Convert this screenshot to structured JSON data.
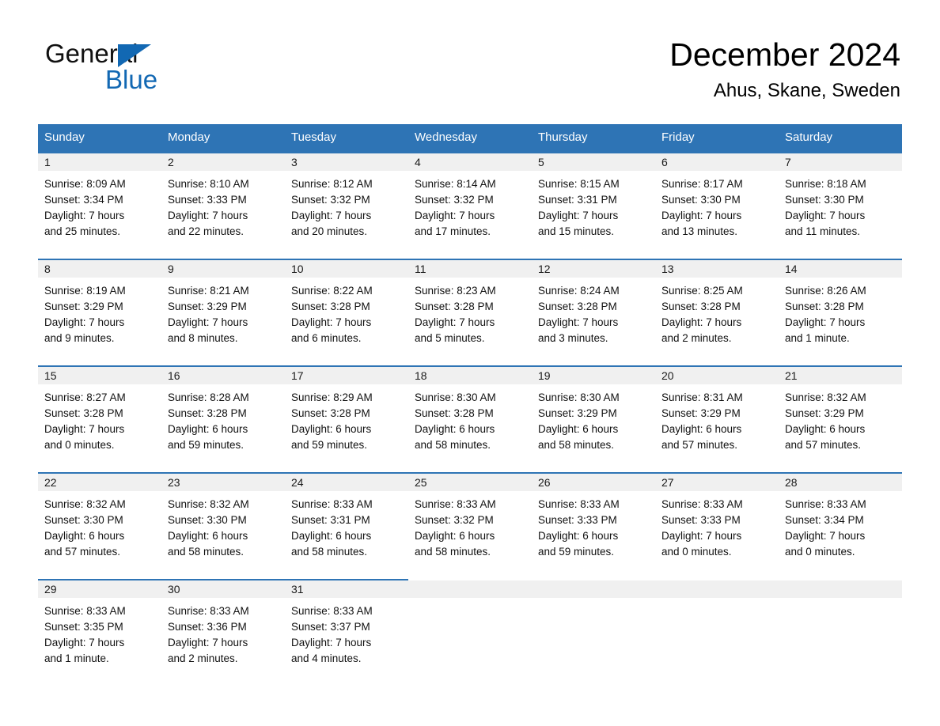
{
  "brand": {
    "line1": "General",
    "line2": "Blue",
    "triangle_color": "#1268b3"
  },
  "header": {
    "title": "December 2024",
    "subtitle": "Ahus, Skane, Sweden"
  },
  "colors": {
    "header_blue": "#2e74b5",
    "day_band_gray": "#f0f0f0",
    "text": "#111111"
  },
  "weekdays": [
    "Sunday",
    "Monday",
    "Tuesday",
    "Wednesday",
    "Thursday",
    "Friday",
    "Saturday"
  ],
  "weeks": [
    [
      {
        "day": "1",
        "sunrise": "Sunrise: 8:09 AM",
        "sunset": "Sunset: 3:34 PM",
        "daylight1": "Daylight: 7 hours",
        "daylight2": "and 25 minutes."
      },
      {
        "day": "2",
        "sunrise": "Sunrise: 8:10 AM",
        "sunset": "Sunset: 3:33 PM",
        "daylight1": "Daylight: 7 hours",
        "daylight2": "and 22 minutes."
      },
      {
        "day": "3",
        "sunrise": "Sunrise: 8:12 AM",
        "sunset": "Sunset: 3:32 PM",
        "daylight1": "Daylight: 7 hours",
        "daylight2": "and 20 minutes."
      },
      {
        "day": "4",
        "sunrise": "Sunrise: 8:14 AM",
        "sunset": "Sunset: 3:32 PM",
        "daylight1": "Daylight: 7 hours",
        "daylight2": "and 17 minutes."
      },
      {
        "day": "5",
        "sunrise": "Sunrise: 8:15 AM",
        "sunset": "Sunset: 3:31 PM",
        "daylight1": "Daylight: 7 hours",
        "daylight2": "and 15 minutes."
      },
      {
        "day": "6",
        "sunrise": "Sunrise: 8:17 AM",
        "sunset": "Sunset: 3:30 PM",
        "daylight1": "Daylight: 7 hours",
        "daylight2": "and 13 minutes."
      },
      {
        "day": "7",
        "sunrise": "Sunrise: 8:18 AM",
        "sunset": "Sunset: 3:30 PM",
        "daylight1": "Daylight: 7 hours",
        "daylight2": "and 11 minutes."
      }
    ],
    [
      {
        "day": "8",
        "sunrise": "Sunrise: 8:19 AM",
        "sunset": "Sunset: 3:29 PM",
        "daylight1": "Daylight: 7 hours",
        "daylight2": "and 9 minutes."
      },
      {
        "day": "9",
        "sunrise": "Sunrise: 8:21 AM",
        "sunset": "Sunset: 3:29 PM",
        "daylight1": "Daylight: 7 hours",
        "daylight2": "and 8 minutes."
      },
      {
        "day": "10",
        "sunrise": "Sunrise: 8:22 AM",
        "sunset": "Sunset: 3:28 PM",
        "daylight1": "Daylight: 7 hours",
        "daylight2": "and 6 minutes."
      },
      {
        "day": "11",
        "sunrise": "Sunrise: 8:23 AM",
        "sunset": "Sunset: 3:28 PM",
        "daylight1": "Daylight: 7 hours",
        "daylight2": "and 5 minutes."
      },
      {
        "day": "12",
        "sunrise": "Sunrise: 8:24 AM",
        "sunset": "Sunset: 3:28 PM",
        "daylight1": "Daylight: 7 hours",
        "daylight2": "and 3 minutes."
      },
      {
        "day": "13",
        "sunrise": "Sunrise: 8:25 AM",
        "sunset": "Sunset: 3:28 PM",
        "daylight1": "Daylight: 7 hours",
        "daylight2": "and 2 minutes."
      },
      {
        "day": "14",
        "sunrise": "Sunrise: 8:26 AM",
        "sunset": "Sunset: 3:28 PM",
        "daylight1": "Daylight: 7 hours",
        "daylight2": "and 1 minute."
      }
    ],
    [
      {
        "day": "15",
        "sunrise": "Sunrise: 8:27 AM",
        "sunset": "Sunset: 3:28 PM",
        "daylight1": "Daylight: 7 hours",
        "daylight2": "and 0 minutes."
      },
      {
        "day": "16",
        "sunrise": "Sunrise: 8:28 AM",
        "sunset": "Sunset: 3:28 PM",
        "daylight1": "Daylight: 6 hours",
        "daylight2": "and 59 minutes."
      },
      {
        "day": "17",
        "sunrise": "Sunrise: 8:29 AM",
        "sunset": "Sunset: 3:28 PM",
        "daylight1": "Daylight: 6 hours",
        "daylight2": "and 59 minutes."
      },
      {
        "day": "18",
        "sunrise": "Sunrise: 8:30 AM",
        "sunset": "Sunset: 3:28 PM",
        "daylight1": "Daylight: 6 hours",
        "daylight2": "and 58 minutes."
      },
      {
        "day": "19",
        "sunrise": "Sunrise: 8:30 AM",
        "sunset": "Sunset: 3:29 PM",
        "daylight1": "Daylight: 6 hours",
        "daylight2": "and 58 minutes."
      },
      {
        "day": "20",
        "sunrise": "Sunrise: 8:31 AM",
        "sunset": "Sunset: 3:29 PM",
        "daylight1": "Daylight: 6 hours",
        "daylight2": "and 57 minutes."
      },
      {
        "day": "21",
        "sunrise": "Sunrise: 8:32 AM",
        "sunset": "Sunset: 3:29 PM",
        "daylight1": "Daylight: 6 hours",
        "daylight2": "and 57 minutes."
      }
    ],
    [
      {
        "day": "22",
        "sunrise": "Sunrise: 8:32 AM",
        "sunset": "Sunset: 3:30 PM",
        "daylight1": "Daylight: 6 hours",
        "daylight2": "and 57 minutes."
      },
      {
        "day": "23",
        "sunrise": "Sunrise: 8:32 AM",
        "sunset": "Sunset: 3:30 PM",
        "daylight1": "Daylight: 6 hours",
        "daylight2": "and 58 minutes."
      },
      {
        "day": "24",
        "sunrise": "Sunrise: 8:33 AM",
        "sunset": "Sunset: 3:31 PM",
        "daylight1": "Daylight: 6 hours",
        "daylight2": "and 58 minutes."
      },
      {
        "day": "25",
        "sunrise": "Sunrise: 8:33 AM",
        "sunset": "Sunset: 3:32 PM",
        "daylight1": "Daylight: 6 hours",
        "daylight2": "and 58 minutes."
      },
      {
        "day": "26",
        "sunrise": "Sunrise: 8:33 AM",
        "sunset": "Sunset: 3:33 PM",
        "daylight1": "Daylight: 6 hours",
        "daylight2": "and 59 minutes."
      },
      {
        "day": "27",
        "sunrise": "Sunrise: 8:33 AM",
        "sunset": "Sunset: 3:33 PM",
        "daylight1": "Daylight: 7 hours",
        "daylight2": "and 0 minutes."
      },
      {
        "day": "28",
        "sunrise": "Sunrise: 8:33 AM",
        "sunset": "Sunset: 3:34 PM",
        "daylight1": "Daylight: 7 hours",
        "daylight2": "and 0 minutes."
      }
    ],
    [
      {
        "day": "29",
        "sunrise": "Sunrise: 8:33 AM",
        "sunset": "Sunset: 3:35 PM",
        "daylight1": "Daylight: 7 hours",
        "daylight2": "and 1 minute."
      },
      {
        "day": "30",
        "sunrise": "Sunrise: 8:33 AM",
        "sunset": "Sunset: 3:36 PM",
        "daylight1": "Daylight: 7 hours",
        "daylight2": "and 2 minutes."
      },
      {
        "day": "31",
        "sunrise": "Sunrise: 8:33 AM",
        "sunset": "Sunset: 3:37 PM",
        "daylight1": "Daylight: 7 hours",
        "daylight2": "and 4 minutes."
      },
      {
        "day": "",
        "sunrise": "",
        "sunset": "",
        "daylight1": "",
        "daylight2": ""
      },
      {
        "day": "",
        "sunrise": "",
        "sunset": "",
        "daylight1": "",
        "daylight2": ""
      },
      {
        "day": "",
        "sunrise": "",
        "sunset": "",
        "daylight1": "",
        "daylight2": ""
      },
      {
        "day": "",
        "sunrise": "",
        "sunset": "",
        "daylight1": "",
        "daylight2": ""
      }
    ]
  ]
}
